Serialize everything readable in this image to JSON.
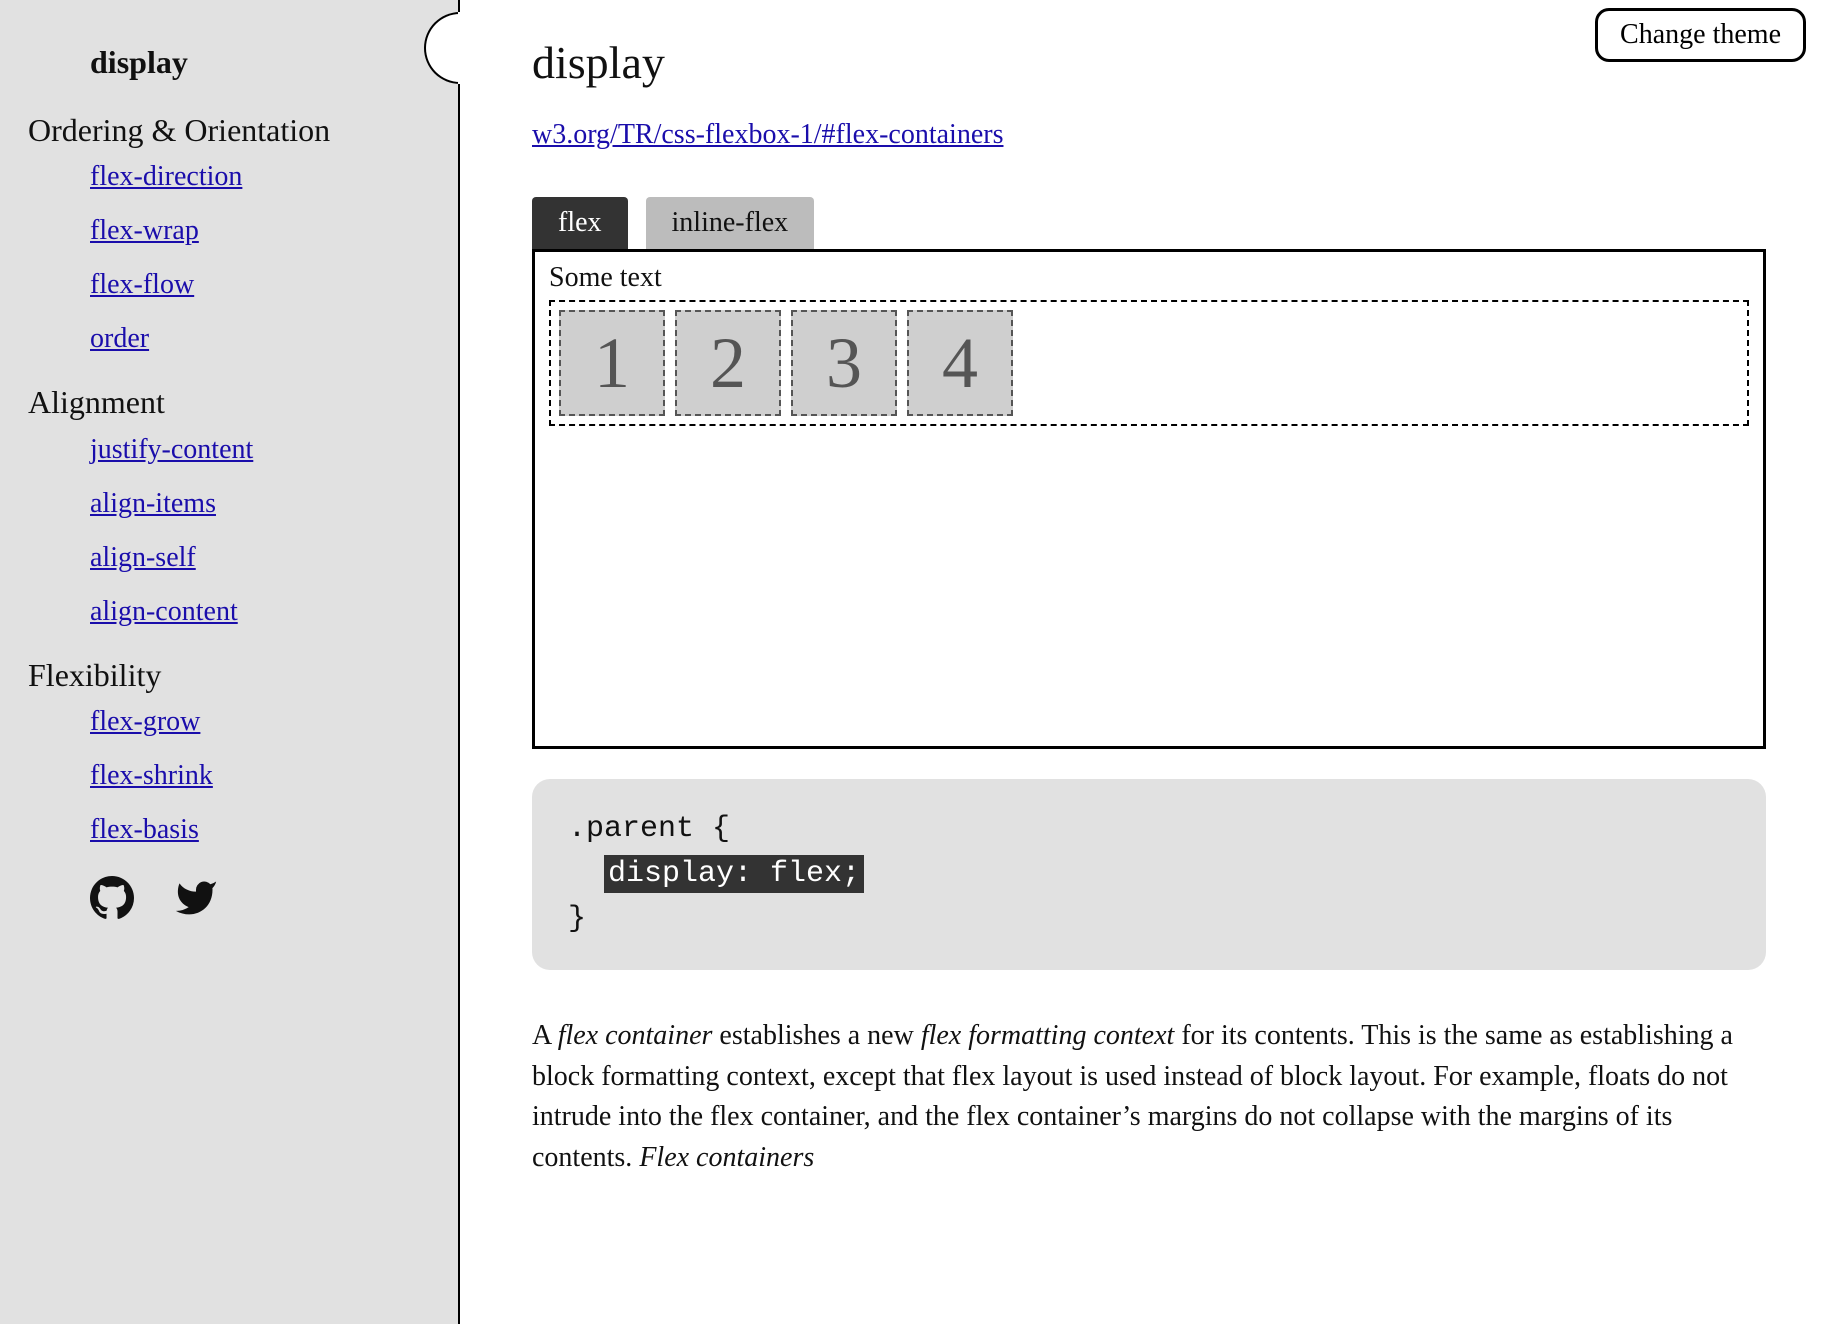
{
  "header": {
    "change_theme": "Change theme"
  },
  "sidebar": {
    "current": "display",
    "sections": [
      {
        "title": "Ordering & Orientation",
        "items": [
          "flex-direction",
          "flex-wrap",
          "flex-flow",
          "order"
        ]
      },
      {
        "title": "Alignment",
        "items": [
          "justify-content",
          "align-items",
          "align-self",
          "align-content"
        ]
      },
      {
        "title": "Flexibility",
        "items": [
          "flex-grow",
          "flex-shrink",
          "flex-basis"
        ]
      }
    ]
  },
  "page": {
    "title": "display",
    "spec_url": "w3.org/TR/css-flexbox-1/#flex-containers",
    "tabs": {
      "active": "flex",
      "inactive": "inline-flex"
    },
    "demo_label": "Some text",
    "items": [
      "1",
      "2",
      "3",
      "4"
    ],
    "code": {
      "open": ".parent {",
      "rule": "display: flex;",
      "close": "}"
    },
    "para": {
      "t1": "A ",
      "e1": "flex container",
      "t2": " establishes a new ",
      "e2": "flex formatting context",
      "t3": " for its contents. This is the same as establishing a block formatting context, except that flex layout is used instead of block layout. For example, floats do not intrude into the flex container, and the flex container’s margins do not collapse with the margins of its contents. ",
      "e3": "Flex containers"
    }
  }
}
